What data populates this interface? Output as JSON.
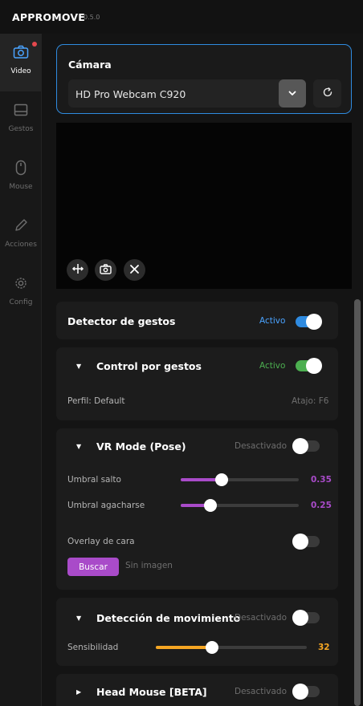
{
  "app": {
    "name": "APPROMOVE",
    "version": "0.5.0"
  },
  "sidebar": {
    "items": [
      {
        "label": "Video",
        "icon": "camera-icon",
        "active": true
      },
      {
        "label": "Gestos",
        "icon": "gestures-icon"
      },
      {
        "label": "Mouse",
        "icon": "mouse-icon"
      },
      {
        "label": "Acciones",
        "icon": "pencil-icon"
      },
      {
        "label": "Config",
        "icon": "gear-icon"
      }
    ]
  },
  "camera": {
    "title": "Cámara",
    "selected": "HD Pro Webcam C920"
  },
  "video_controls": [
    "move-icon",
    "snapshot-icon",
    "close-icon"
  ],
  "colors": {
    "accent_blue": "#2f8be0",
    "active_green": "#4caf50",
    "slider_purple": "#a94bc9",
    "slider_orange": "#f5a623",
    "notification_red": "#e5484d"
  },
  "detector": {
    "title": "Detector de gestos",
    "status": "Activo",
    "enabled": true
  },
  "control": {
    "title": "Control por gestos",
    "status": "Activo",
    "enabled": true,
    "profile": "Perfil: Default",
    "shortcut": "Atajo: F6"
  },
  "vr": {
    "title": "VR Mode (Pose)",
    "status": "Desactivado",
    "enabled": false,
    "sliders": [
      {
        "label": "Umbral salto",
        "value": "0.35",
        "fraction": 0.35
      },
      {
        "label": "Umbral agacharse",
        "value": "0.25",
        "fraction": 0.25
      }
    ],
    "overlay_label": "Overlay de cara",
    "overlay_enabled": false,
    "buscar_label": "Buscar",
    "no_image": "Sin imagen"
  },
  "motion": {
    "title": "Detección de movimiento",
    "status": "Desactivado",
    "enabled": false,
    "sensitivity_label": "Sensibilidad",
    "sensitivity_value": "32",
    "sensitivity_fraction": 0.37
  },
  "head_mouse": {
    "title": "Head Mouse [BETA]",
    "status": "Desactivado",
    "enabled": false
  }
}
